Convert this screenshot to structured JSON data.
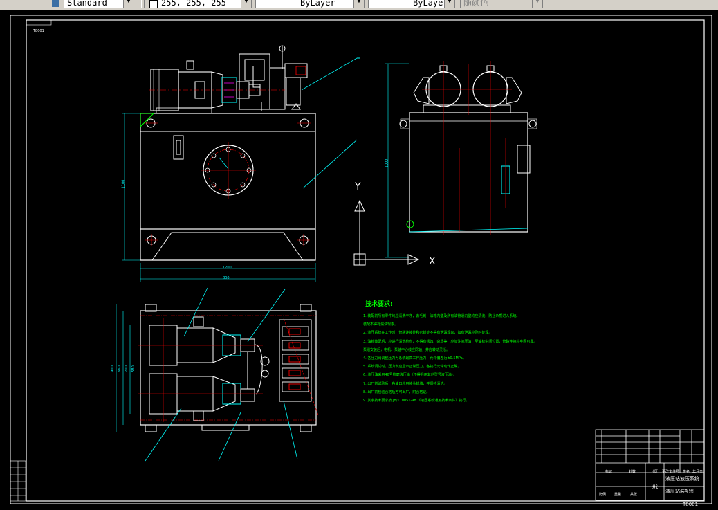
{
  "toolbar": {
    "text_style": "Standard",
    "color_value": "255, 255, 255",
    "linetype": "ByLayer",
    "lineweight": "ByLayer",
    "plot_style": "随颜色"
  },
  "drawing": {
    "frame_tag": "T8001",
    "ucs_labels": {
      "y": "Y",
      "x": "X"
    },
    "technical_notes": {
      "title": "技术要求:",
      "lines": [
        "1. 装配前所有零件均应清洗干净，去毛刺，油箱内壁及所有油管道内壁均应清洗，防止杂质进入系统。",
        "    装配不得有漏油现象。",
        "2. 液压系统在工作时，管路连接处和密封处不得有泄漏现象，如有泄漏应及时处理。",
        "3. 油箱装配后，应进行清洗检查，不得有锈蚀、杂质等，应加注液压油，至油标中间位置，管路连接应牢固可靠。",
        "    泵组安装后，电机、泵轴中心线应同轴，并应转动灵活。",
        "4. 各压力阀调整压力为系统最高工作压力，允许偏差为±0.5MPa。",
        "5. 系统调试时，压力表应显示正常压力，各执行元件动作正确。",
        "6. 液压油采用46号抗磨液压油（不得混用其他型号液压油）。",
        "7. 出厂前试验后，各油口应用堵头封堵，并保持清洁。",
        "8. 出厂前检验合格后方可出厂，附合格证。",
        "9. 其余技术要求按 JB/T10051-98 《液压系统通用技术条件》执行。"
      ]
    },
    "title_block": {
      "design_label": "设计",
      "title_line1": "液压站液压系统",
      "title_line2": "液压站装配图",
      "drawing_number": "T8001",
      "small_labels": [
        "标记",
        "处数",
        "分区",
        "更改文件号",
        "签名",
        "年月日"
      ],
      "col_labels": [
        "比例",
        "重量",
        "共张"
      ]
    },
    "dimension_labels": [
      "1100",
      "1200",
      "800",
      "1000",
      "900",
      "660",
      "700",
      "580"
    ]
  }
}
